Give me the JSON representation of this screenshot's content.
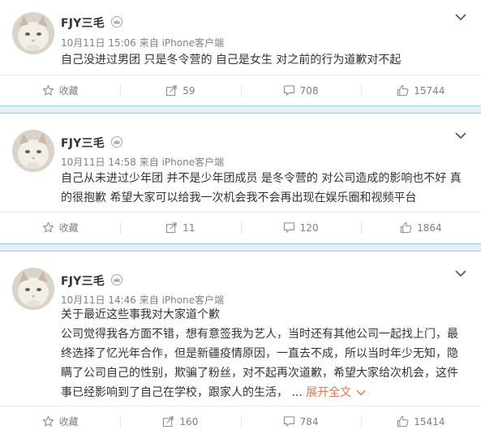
{
  "posts": [
    {
      "username": "FJY三毛",
      "meta": "10月11日 15:06 来自 iPhone客户端",
      "lines": [
        "自己没进过男团 只是冬令营的 自己是女生 对之前的行为道歉对不起"
      ],
      "expand_label": "",
      "actions": {
        "favorite": "收藏",
        "repost": "59",
        "comment": "708",
        "like": "15744"
      }
    },
    {
      "username": "FJY三毛",
      "meta": "10月11日 14:58 来自 iPhone客户端",
      "lines": [
        "自己从未进过少年团 并不是少年团成员 是冬令营的 对公司造成的影响也不好 真",
        "的很抱歉 希望大家可以给我一次机会我不会再出现在娱乐圈和视频平台"
      ],
      "expand_label": "",
      "actions": {
        "favorite": "收藏",
        "repost": "11",
        "comment": "120",
        "like": "1864"
      }
    },
    {
      "username": "FJY三毛",
      "meta": "10月11日 14:46 来自 iPhone客户端",
      "lines": [
        "关于最近这些事我对大家道个歉",
        "公司觉得我各方面不错，想有意签我为艺人，当时还有其他公司一起找上门，最",
        "终选择了忆光年合作，但是新疆疫情原因，一直去不成，所以当时年少无知，隐",
        "瞒了公司自己的性别，欺骗了粉丝，对不起再次道歉，希望大家给次机会，这件",
        "事已经影响到了自己在学校，跟家人的生活，  ... "
      ],
      "expand_label": "展开全文",
      "actions": {
        "favorite": "收藏",
        "repost": "160",
        "comment": "784",
        "like": "15414"
      }
    }
  ]
}
